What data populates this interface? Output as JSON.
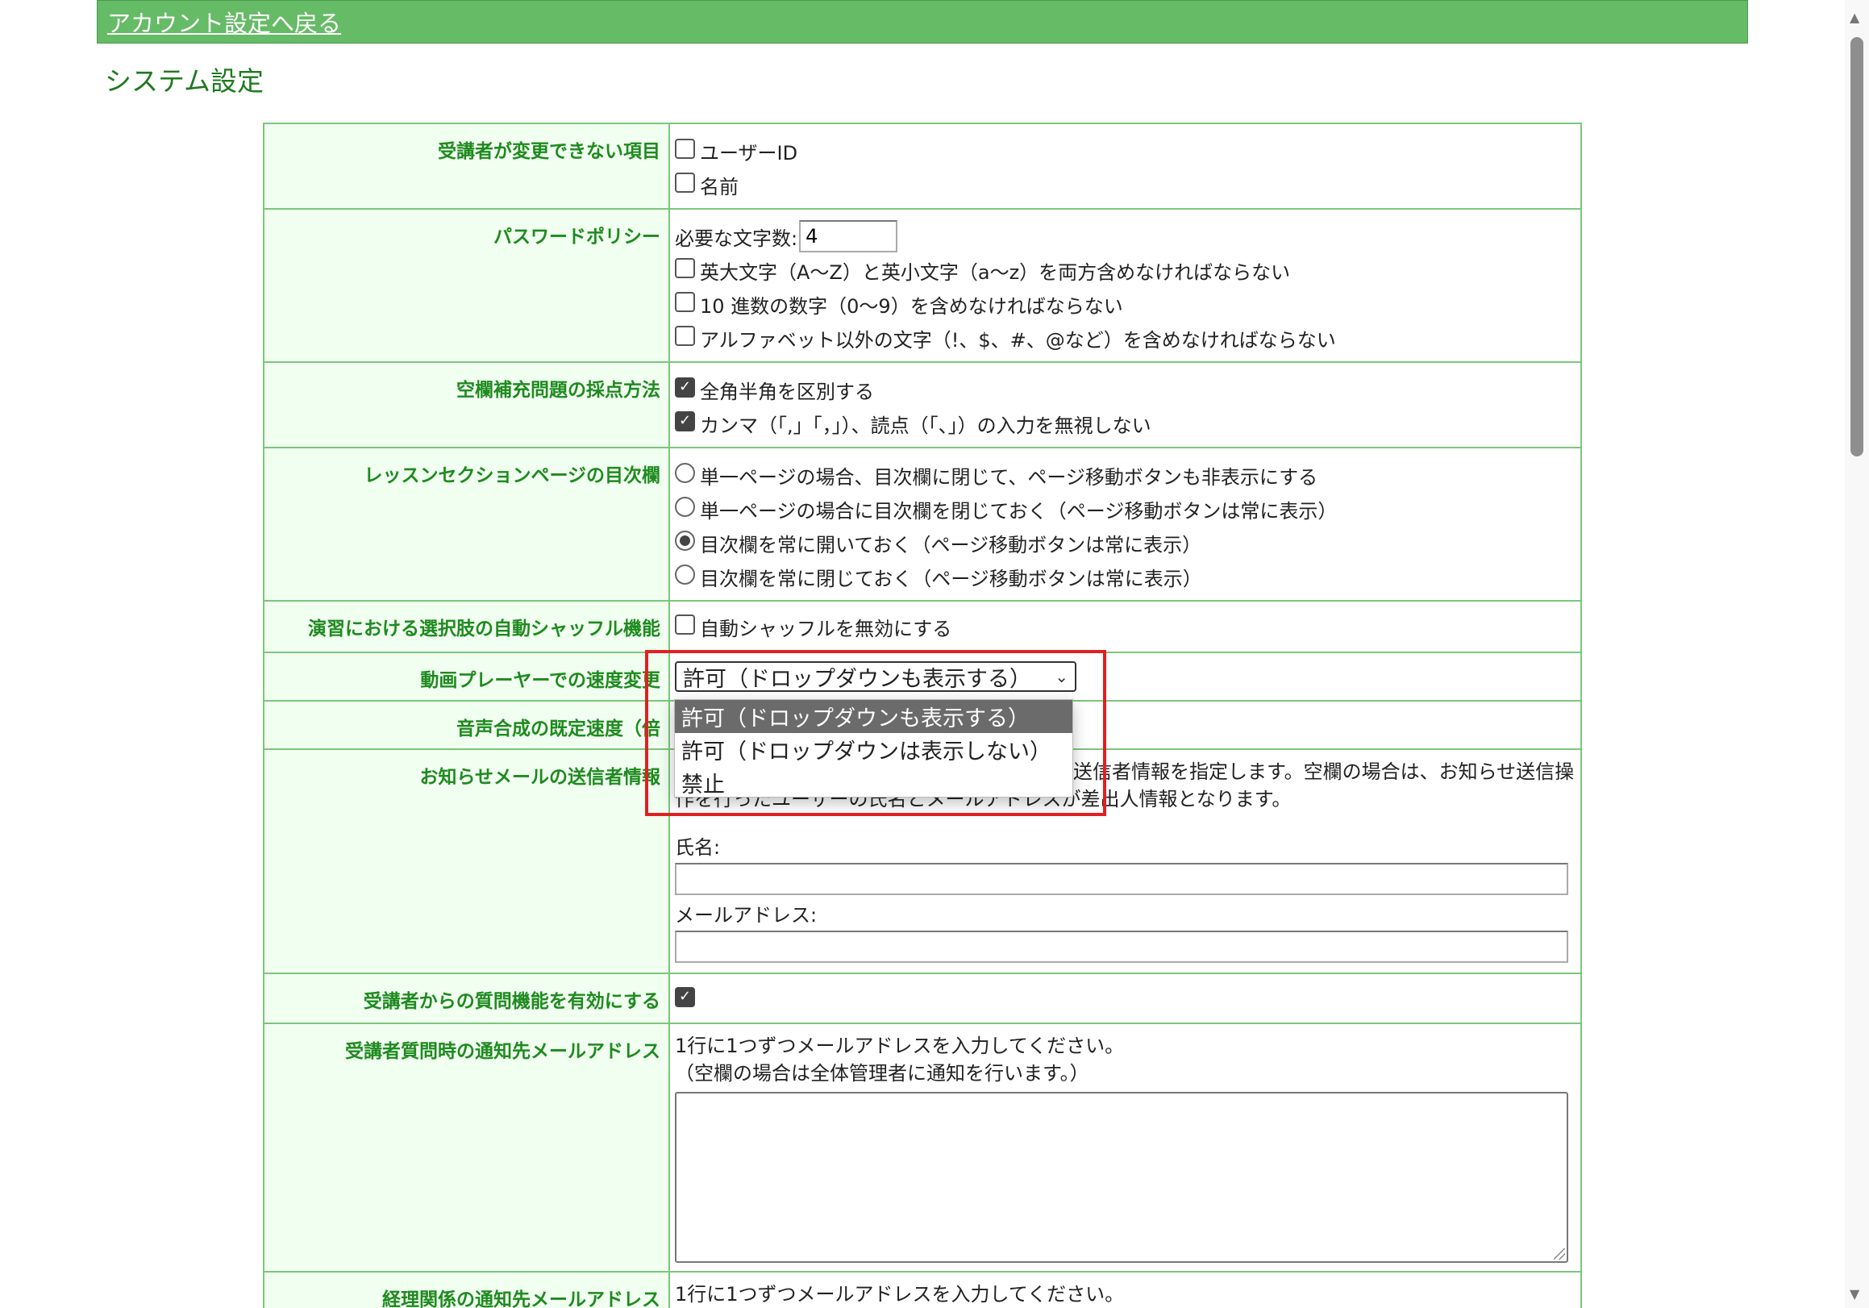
{
  "header": {
    "back_link": "アカウント設定へ戻る"
  },
  "page_title": "システム設定",
  "rows": {
    "locked_items": {
      "label": "受講者が変更できない項目",
      "options": [
        {
          "label": "ユーザーID",
          "checked": false
        },
        {
          "label": "名前",
          "checked": false
        }
      ]
    },
    "password_policy": {
      "label": "パスワードポリシー",
      "min_length_label": "必要な文字数:",
      "min_length_value": "4",
      "options": [
        {
          "label": "英大文字（A～Z）と英小文字（a～z）を両方含めなければならない",
          "checked": false
        },
        {
          "label": "10 進数の数字（0～9）を含めなければならない",
          "checked": false
        },
        {
          "label": "アルファベット以外の文字（!、$、#、@など）を含めなければならない",
          "checked": false
        }
      ]
    },
    "blank_scoring": {
      "label": "空欄補充問題の採点方法",
      "options": [
        {
          "label": "全角半角を区別する",
          "checked": true
        },
        {
          "label": "カンマ（「,」「，」）、読点（「、」）の入力を無視しない",
          "checked": true
        }
      ]
    },
    "lesson_toc": {
      "label": "レッスンセクションページの目次欄",
      "options": [
        {
          "label": "単一ページの場合、目次欄に閉じて、ページ移動ボタンも非表示にする",
          "selected": false
        },
        {
          "label": "単一ページの場合に目次欄を閉じておく（ページ移動ボタンは常に表示）",
          "selected": false
        },
        {
          "label": "目次欄を常に開いておく（ページ移動ボタンは常に表示）",
          "selected": true
        },
        {
          "label": "目次欄を常に閉じておく（ページ移動ボタンは常に表示）",
          "selected": false
        }
      ]
    },
    "shuffle": {
      "label": "演習における選択肢の自動シャッフル機能",
      "option": {
        "label": "自動シャッフルを無効にする",
        "checked": false
      }
    },
    "video_speed": {
      "label": "動画プレーヤーでの速度変更",
      "selected": "許可（ドロップダウンも表示する）",
      "dropdown_options": [
        "許可（ドロップダウンも表示する）",
        "許可（ドロップダウンは表示しない）",
        "禁止"
      ]
    },
    "tts_speed": {
      "label": "音声合成の既定速度（倍"
    },
    "notice_sender": {
      "label": "お知らせメールの送信者情報",
      "description_line1": "送信者情報を指定します。空欄の場合は、お知らせ送信操",
      "description_line2": "作を行ったユーザーの氏名とメールアドレスが差出人情報となります。",
      "name_label": "氏名:",
      "name_value": "",
      "email_label": "メールアドレス:",
      "email_value": ""
    },
    "question_feature": {
      "label": "受講者からの質問機能を有効にする",
      "checked": true
    },
    "question_notify": {
      "label": "受講者質問時の通知先メールアドレス",
      "help_line1": "1行に1つずつメールアドレスを入力してください。",
      "help_line2": "（空欄の場合は全体管理者に通知を行います。）",
      "value": ""
    },
    "accounting_notify": {
      "label": "経理関係の通知先メールアドレス",
      "help_line1": "1行に1つずつメールアドレスを入力してください。"
    }
  },
  "colors": {
    "header_bg": "#66bb66",
    "label_text": "#1f8a1f",
    "label_bg": "#f0fff0",
    "highlight": "#e02020"
  }
}
